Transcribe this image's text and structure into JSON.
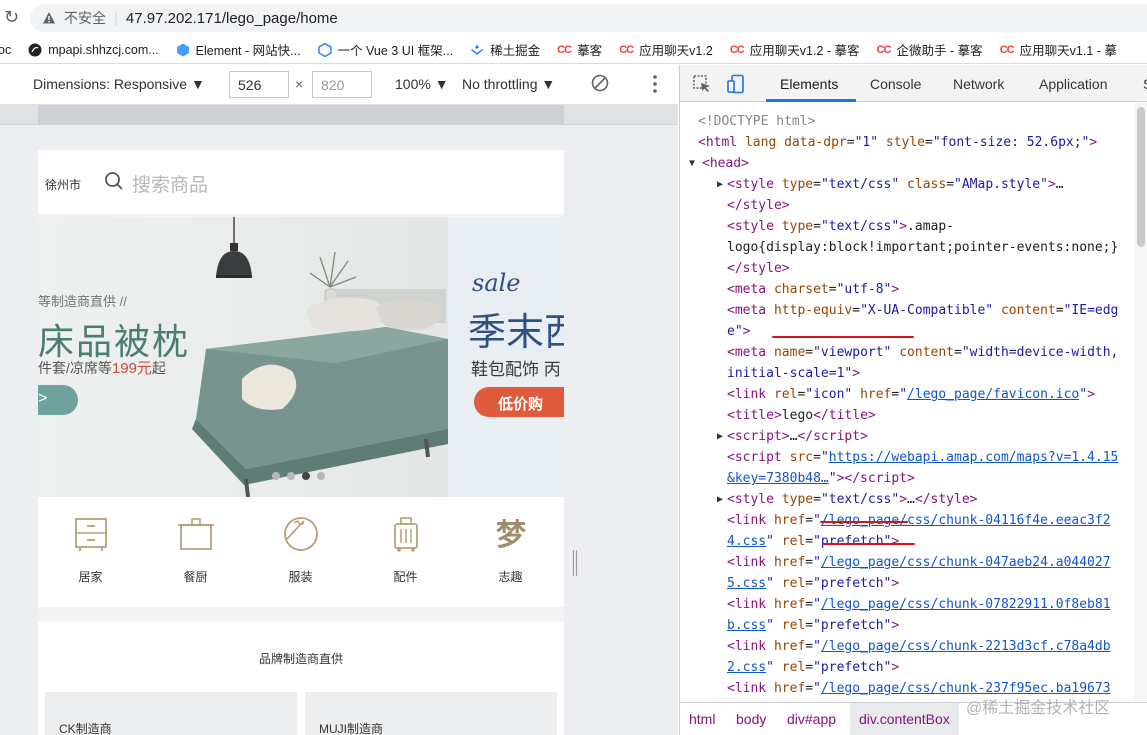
{
  "browser": {
    "security_label": "不安全",
    "url": "47.97.202.171/lego_page/home",
    "bookmarks": [
      {
        "label": "oc",
        "icon": "none"
      },
      {
        "label": "mpapi.shhzcj.com...",
        "icon": "globe-icon"
      },
      {
        "label": "Element - 网站快...",
        "icon": "element-icon"
      },
      {
        "label": "一个 Vue 3 UI 框架...",
        "icon": "vue-icon"
      },
      {
        "label": "稀土掘金",
        "icon": "juejin-icon"
      },
      {
        "label": "摹客",
        "icon": "cc-icon"
      },
      {
        "label": "应用聊天v1.2",
        "icon": "cc-icon"
      },
      {
        "label": "应用聊天v1.2 - 摹客",
        "icon": "cc-icon"
      },
      {
        "label": "企微助手 - 摹客",
        "icon": "cc-icon"
      },
      {
        "label": "应用聊天v1.1 - 摹",
        "icon": "cc-icon"
      }
    ]
  },
  "device_toolbar": {
    "dimensions_label": "Dimensions: Responsive ▼",
    "width": "526",
    "times": "×",
    "height": "820",
    "zoom": "100% ▼",
    "throttling": "No throttling ▼"
  },
  "mobile_page": {
    "city": "徐州市",
    "search_placeholder": "搜索商品",
    "banner1": {
      "sub": "等制造商直供 //",
      "title": "床品被枕",
      "desc_pre": "件套/凉席等",
      "desc_price": "199元",
      "desc_post": "起",
      "btn": ">"
    },
    "banner2": {
      "sale": "sale",
      "title": "季末西",
      "desc": "鞋包配饰 丙",
      "btn": "低价购"
    },
    "carousel": {
      "count": 4,
      "active": 2
    },
    "categories": [
      {
        "label": "居家",
        "icon": "cabinet-icon"
      },
      {
        "label": "餐厨",
        "icon": "pot-icon"
      },
      {
        "label": "服装",
        "icon": "clothing-icon"
      },
      {
        "label": "配件",
        "icon": "luggage-icon"
      },
      {
        "label": "志趣",
        "icon": "hobby-icon"
      }
    ],
    "brand": {
      "title": "品牌制造商直供",
      "cards": [
        "CK制造商",
        "MUJI制造商"
      ]
    }
  },
  "devtools": {
    "tabs": [
      "Elements",
      "Console",
      "Network",
      "Application",
      "S"
    ],
    "active_tab": "Elements",
    "code_lines": [
      {
        "indent": 0,
        "tri": "",
        "html": "<span class='cm'>&lt;!DOCTYPE html&gt;</span>"
      },
      {
        "indent": 0,
        "tri": "",
        "html": "<span class='tag'>&lt;html</span> <span class='an'>lang</span> <span class='an'>data-dpr</span>=<span class='av'>\"1\"</span> <span class='an'>style</span>=<span class='av'>\"font-size: 52.6px;\"</span><span class='tag'>&gt;</span>"
      },
      {
        "indent": 1,
        "tri": "▼",
        "html": "<span class='tag'>&lt;head&gt;</span>"
      },
      {
        "indent": 2,
        "tri": "▶",
        "html": "<span class='tag'>&lt;style</span> <span class='an'>type</span>=<span class='av'>\"text/css\"</span> <span class='an'>class</span>=<span class='av'>\"AMap.style\"</span><span class='tag'>&gt;</span><span class='tx'>…</span>"
      },
      {
        "indent": 2,
        "tri": "",
        "html": "<span class='tag'>&lt;/style&gt;</span>"
      },
      {
        "indent": 2,
        "tri": "",
        "html": "<span class='tag'>&lt;style</span> <span class='an'>type</span>=<span class='av'>\"text/css\"</span><span class='tag'>&gt;</span><span class='tx'>.amap-</span>"
      },
      {
        "indent": 2,
        "tri": "",
        "html": "<span class='tx'>logo{display:block!important;pointer-events:none;}</span>"
      },
      {
        "indent": 2,
        "tri": "",
        "html": "<span class='tag'>&lt;/style&gt;</span>"
      },
      {
        "indent": 2,
        "tri": "",
        "html": "<span class='tag'>&lt;meta</span> <span class='an'>charset</span>=<span class='av'>\"utf-8\"</span><span class='tag'>&gt;</span>"
      },
      {
        "indent": 2,
        "tri": "",
        "html": "<span class='tag'>&lt;meta</span> <span class='an'>http-equiv</span>=<span class='av'>\"X-UA-Compatible\"</span> <span class='an'>content</span>=<span class='av'>\"IE=edg</span>"
      },
      {
        "indent": 2,
        "tri": "",
        "html": "<span class='av'>e\"</span><span class='tag'>&gt;</span>"
      },
      {
        "indent": 2,
        "tri": "",
        "html": "<span class='tag'>&lt;meta</span> <span class='an'>name</span>=<span class='av'>\"viewport\"</span> <span class='an'>content</span>=<span class='av'>\"width=device-width,</span>"
      },
      {
        "indent": 2,
        "tri": "",
        "html": "<span class='av'>initial-scale=1\"</span><span class='tag'>&gt;</span>"
      },
      {
        "indent": 2,
        "tri": "",
        "html": "<span class='tag'>&lt;link</span> <span class='an'>rel</span>=<span class='av'>\"icon\"</span> <span class='an'>href</span>=<span class='av'>\"</span><span class='lk'>/lego_page/favicon.ico</span><span class='av'>\"</span><span class='tag'>&gt;</span>"
      },
      {
        "indent": 2,
        "tri": "",
        "html": "<span class='tag'>&lt;title&gt;</span><span class='tx'>lego</span><span class='tag'>&lt;/title&gt;</span>"
      },
      {
        "indent": 2,
        "tri": "▶",
        "html": "<span class='tag'>&lt;script&gt;</span><span class='tx'>…</span><span class='tag'>&lt;/script&gt;</span>"
      },
      {
        "indent": 2,
        "tri": "",
        "html": "<span class='tag'>&lt;script</span> <span class='an'>src</span>=<span class='av'>\"</span><span class='lk'>https://webapi.amap.com/maps?v=1.4.15</span>"
      },
      {
        "indent": 2,
        "tri": "",
        "html": "<span class='lk'>&amp;key=7380b48…</span><span class='av'>\"</span><span class='tag'>&gt;&lt;/script&gt;</span>"
      },
      {
        "indent": 2,
        "tri": "▶",
        "html": "<span class='tag'>&lt;style</span> <span class='an'>type</span>=<span class='av'>\"text/css\"</span><span class='tag'>&gt;</span><span class='tx'>…</span><span class='tag'>&lt;/style&gt;</span>"
      },
      {
        "indent": 2,
        "tri": "",
        "html": "<span class='tag'>&lt;link</span> <span class='an'>href</span>=<span class='av'>\"</span><span class='lk'>/lego_page/css/chunk-04116f4e.eeac3f2</span>"
      },
      {
        "indent": 2,
        "tri": "",
        "html": "<span class='lk'>4.css</span><span class='av'>\"</span> <span class='an'>rel</span>=<span class='av'>\"prefetch\"</span><span class='tag'>&gt;</span>"
      },
      {
        "indent": 2,
        "tri": "",
        "html": "<span class='tag'>&lt;link</span> <span class='an'>href</span>=<span class='av'>\"</span><span class='lk'>/lego_page/css/chunk-047aeb24.a044027</span>"
      },
      {
        "indent": 2,
        "tri": "",
        "html": "<span class='lk'>5.css</span><span class='av'>\"</span> <span class='an'>rel</span>=<span class='av'>\"prefetch\"</span><span class='tag'>&gt;</span>"
      },
      {
        "indent": 2,
        "tri": "",
        "html": "<span class='tag'>&lt;link</span> <span class='an'>href</span>=<span class='av'>\"</span><span class='lk'>/lego_page/css/chunk-07822911.0f8eb81</span>"
      },
      {
        "indent": 2,
        "tri": "",
        "html": "<span class='lk'>b.css</span><span class='av'>\"</span> <span class='an'>rel</span>=<span class='av'>\"prefetch\"</span><span class='tag'>&gt;</span>"
      },
      {
        "indent": 2,
        "tri": "",
        "html": "<span class='tag'>&lt;link</span> <span class='an'>href</span>=<span class='av'>\"</span><span class='lk'>/lego_page/css/chunk-2213d3cf.c78a4db</span>"
      },
      {
        "indent": 2,
        "tri": "",
        "html": "<span class='lk'>2.css</span><span class='av'>\"</span> <span class='an'>rel</span>=<span class='av'>\"prefetch\"</span><span class='tag'>&gt;</span>"
      },
      {
        "indent": 2,
        "tri": "",
        "html": "<span class='tag'>&lt;link</span> <span class='an'>href</span>=<span class='av'>\"</span><span class='lk'>/lego_page/css/chunk-237f95ec.ba19673</span>"
      }
    ],
    "breadcrumbs": [
      "html",
      "body",
      "div#app",
      "div.contentBox"
    ],
    "watermark": "@稀土掘金技术社区"
  }
}
